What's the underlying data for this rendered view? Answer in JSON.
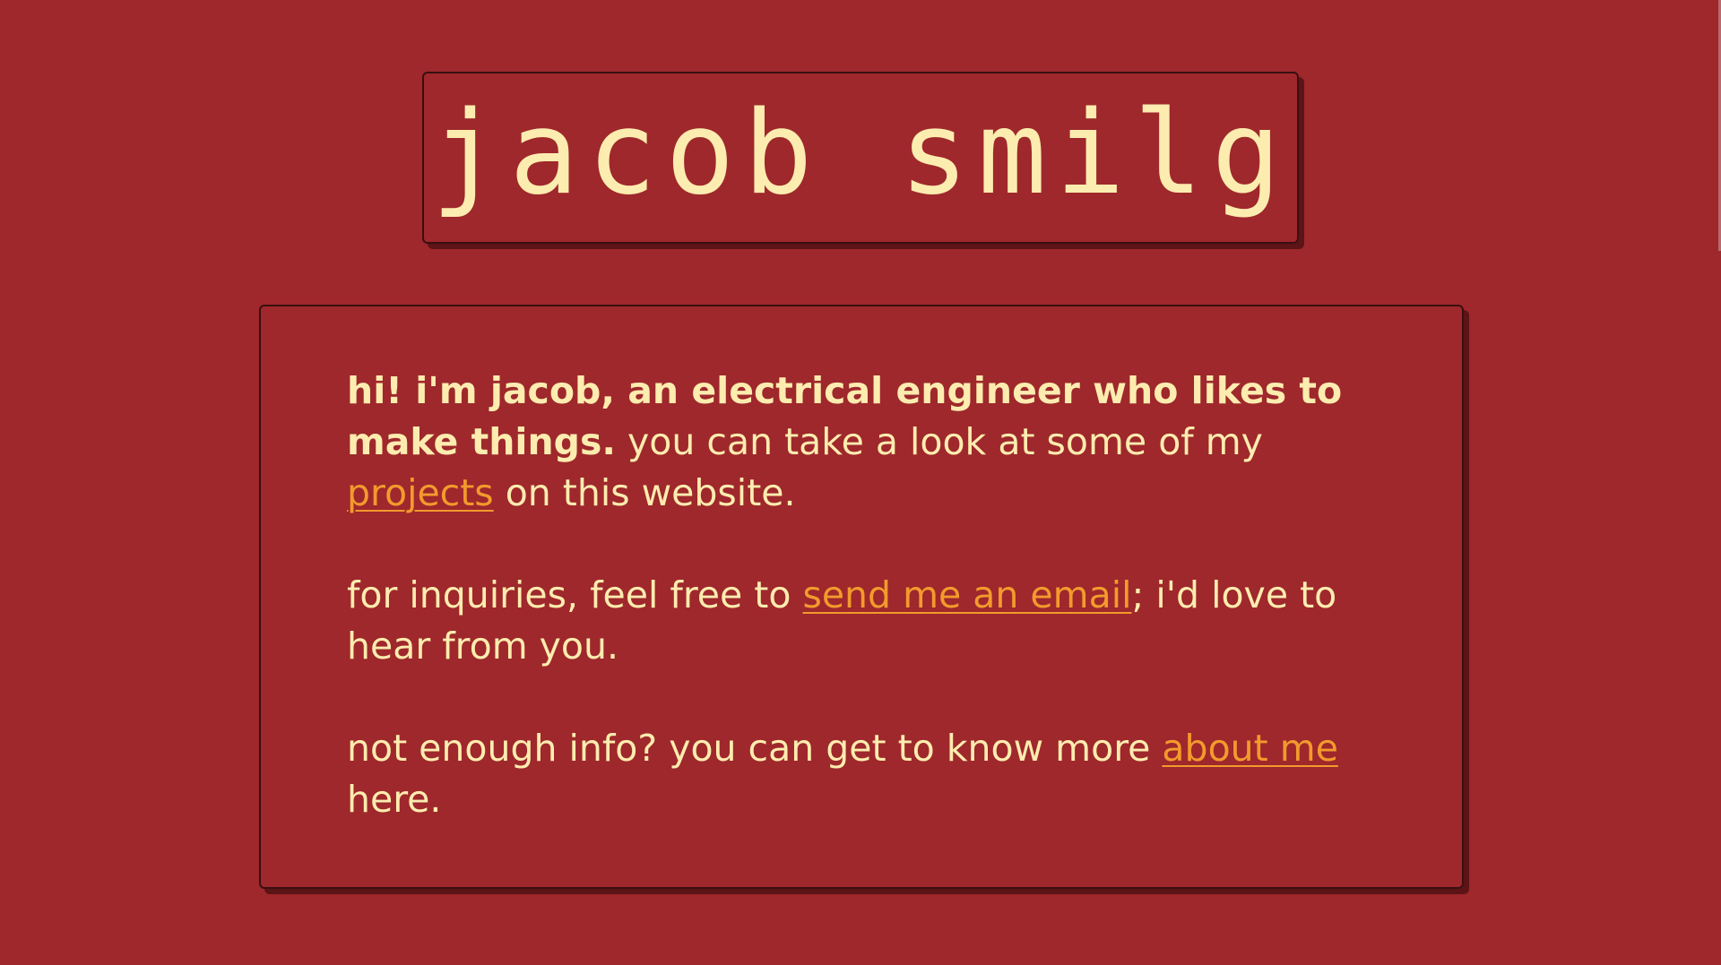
{
  "header": {
    "title": "jacob smilg"
  },
  "intro": {
    "bold": "hi! i'm jacob, an electrical engineer who likes to make things.",
    "text_before_link": " you can take a look at some of my ",
    "projects_link": "projects",
    "text_after_link": " on this website."
  },
  "contact": {
    "text_before_link": "for inquiries, feel free to ",
    "email_link": "send me an email",
    "text_after_link": "; i'd love to hear from you."
  },
  "about": {
    "text_before_link": "not enough info? you can get to know more ",
    "about_link": "about me",
    "text_after_link": " here."
  },
  "colors": {
    "background": "#9E282C",
    "text": "#FDECAF",
    "link": "#F39A2D",
    "border": "#3A0F10",
    "shadow": "#5C1416"
  }
}
